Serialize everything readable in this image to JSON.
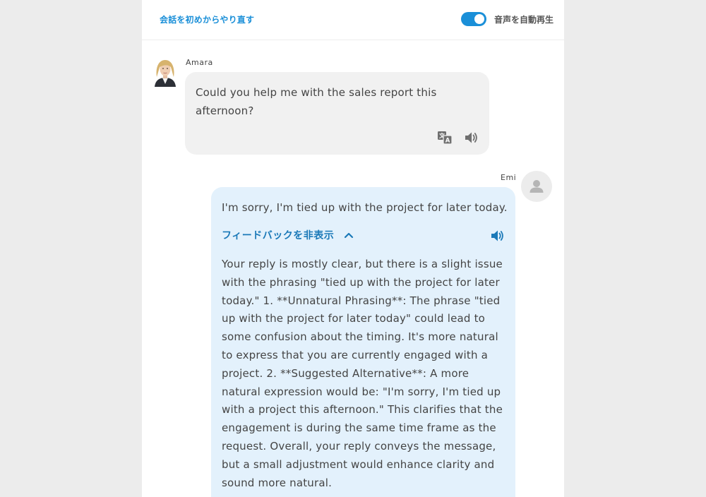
{
  "header": {
    "restart_label": "会話を初めからやり直す",
    "autoplay_label": "音声を自動再生",
    "autoplay_on": true
  },
  "messages": [
    {
      "sender": "Amara",
      "text": "Could you help me with the sales report this afternoon?"
    },
    {
      "sender": "Emi",
      "text": "I'm sorry, I'm tied up with the project for later today.",
      "feedback_toggle_label": "フィードバックを非表示",
      "feedback": "Your reply is mostly clear, but there is a slight issue with the phrasing \"tied up with the project for later today.\" 1. **Unnatural Phrasing**: The phrase \"tied up with the project for later today\" could lead to some confusion about the timing. It's more natural to express that you are currently engaged with a project. 2. **Suggested Alternative**: A more natural expression would be: \"I'm sorry, I'm tied up with a project this afternoon.\" This clarifies that the engagement is during the same time frame as the request. Overall, your reply conveys the message, but a small adjustment would enhance clarity and sound more natural."
    }
  ],
  "colors": {
    "accent": "#1a8fd8",
    "user_bubble": "#e3f1fc",
    "assistant_bubble": "#f1f1f1"
  }
}
